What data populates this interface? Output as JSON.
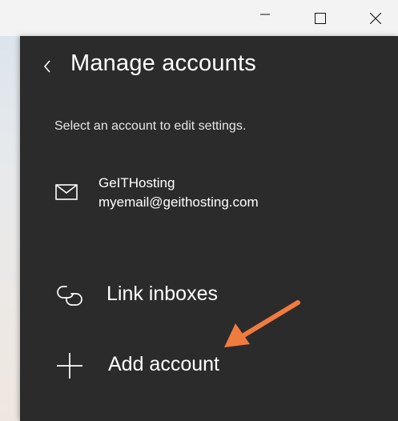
{
  "window": {
    "minimize_icon": "minimize-icon",
    "maximize_icon": "maximize-icon",
    "close_icon": "close-icon"
  },
  "panel": {
    "back_icon": "chevron-left-icon",
    "title": "Manage accounts",
    "subtitle": "Select an account to edit settings."
  },
  "account": {
    "icon": "mail-envelope-icon",
    "name": "GeITHosting",
    "email": "myemail@geithosting.com"
  },
  "actions": {
    "link_inboxes": {
      "icon": "link-icon",
      "label": "Link inboxes"
    },
    "add_account": {
      "icon": "plus-icon",
      "label": "Add account"
    }
  },
  "annotation": {
    "icon": "arrow-pointer-icon",
    "color": "#f07b3f"
  },
  "colors": {
    "panel_background": "#2b2b2b",
    "titlebar_background": "#f3f3f3",
    "text": "#ffffff"
  }
}
